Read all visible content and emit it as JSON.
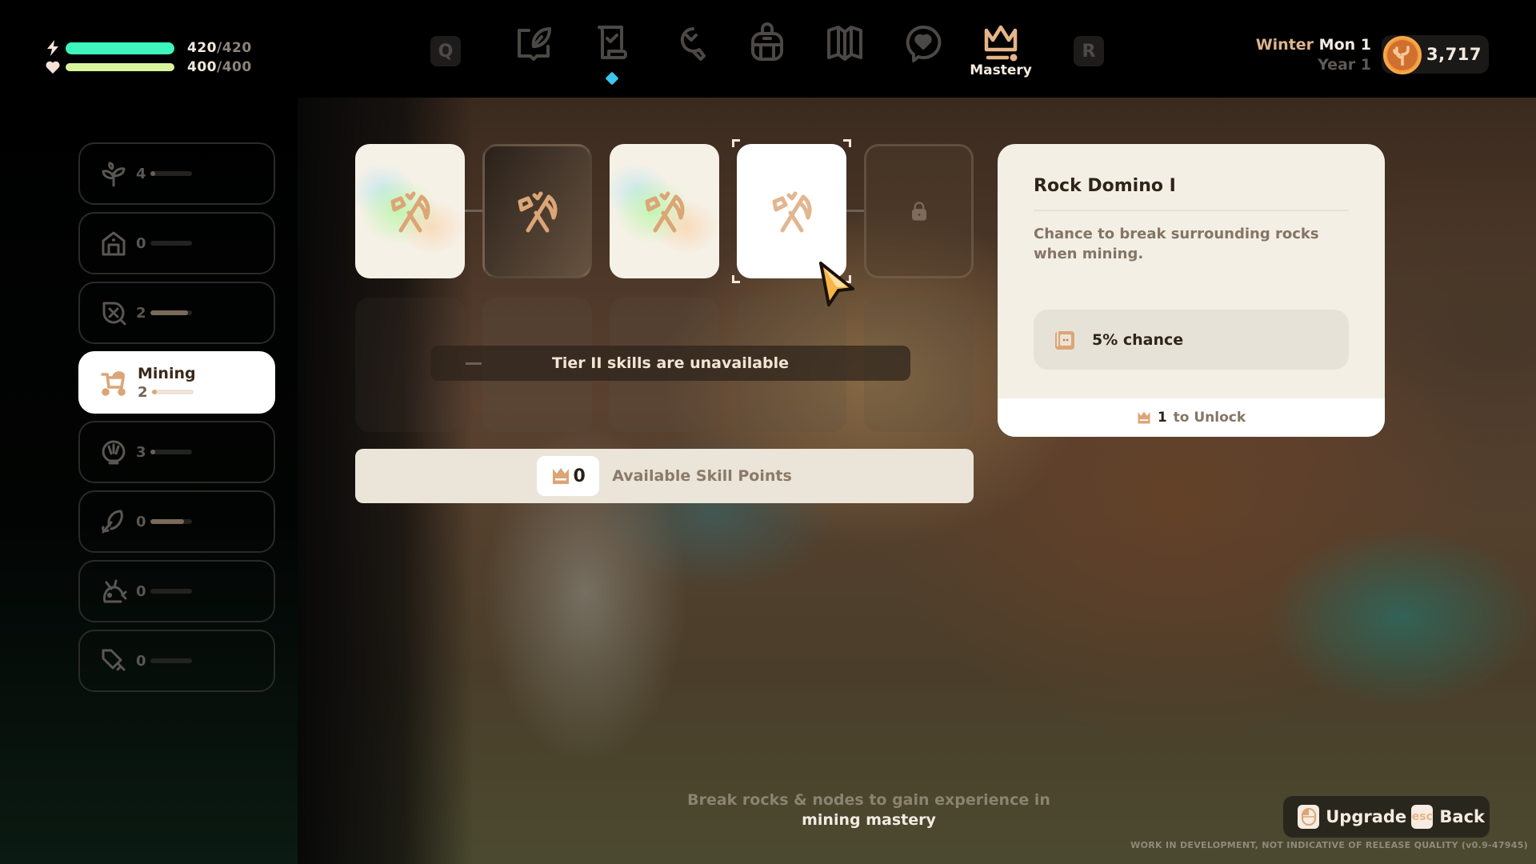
{
  "stats": {
    "energy": {
      "icon": "lightning-icon",
      "current": "420",
      "max": "420",
      "fill": 1.0,
      "color": "#3ef5bb"
    },
    "health": {
      "icon": "heart-icon",
      "current": "400",
      "max": "400",
      "fill": 1.0,
      "color": "#d8f59a"
    }
  },
  "nav": {
    "left_key": "Q",
    "right_key": "R",
    "items": [
      {
        "name": "journal",
        "icon": "leaf-book-icon"
      },
      {
        "name": "quests",
        "icon": "scroll-check-icon",
        "has_notification": true
      },
      {
        "name": "crafting",
        "icon": "wrench-icon"
      },
      {
        "name": "inventory",
        "icon": "backpack-icon"
      },
      {
        "name": "map",
        "icon": "map-icon"
      },
      {
        "name": "relationships",
        "icon": "heart-chat-icon"
      },
      {
        "name": "mastery",
        "icon": "crown-icon",
        "label": "Mastery",
        "active": true
      }
    ],
    "notification_color": "#3cc7ee",
    "active_color": "#e6b48a"
  },
  "calendar": {
    "season": "Winter",
    "day": "Mon 1",
    "year": "Year 1"
  },
  "currency": {
    "icon": "coin-icon",
    "amount": "3,717"
  },
  "sidebar": {
    "items": [
      {
        "icon": "sprout-icon",
        "level": "4",
        "progress": 0.05
      },
      {
        "icon": "barn-icon",
        "level": "0",
        "progress": 0.0
      },
      {
        "icon": "leaf-cross-icon",
        "level": "2",
        "progress": 0.9
      },
      {
        "icon": "mining-cart-icon",
        "name": "Mining",
        "level": "2",
        "progress": 0.05,
        "active": true
      },
      {
        "icon": "shell-icon",
        "level": "3",
        "progress": 0.05
      },
      {
        "icon": "fishing-icon",
        "level": "0",
        "progress": 0.8
      },
      {
        "icon": "fish-icon",
        "level": "0",
        "progress": 0.0
      },
      {
        "icon": "sword-icon",
        "level": "0",
        "progress": 0.0
      }
    ]
  },
  "skills": {
    "tier1": [
      {
        "state": "unlocked",
        "icon": "crossed-axes-icon"
      },
      {
        "state": "available",
        "icon": "crossed-axes-icon"
      },
      {
        "state": "unlocked",
        "icon": "crossed-axes-icon"
      },
      {
        "state": "selected",
        "icon": "crossed-axes-icon"
      },
      {
        "state": "locked",
        "icon": "lock-icon"
      }
    ],
    "tier2_message": "Tier II skills are unavailable",
    "points_value": "0",
    "points_label": "Available Skill Points"
  },
  "detail": {
    "title": "Rock Domino I",
    "description": "Chance to break surrounding rocks when mining.",
    "effect": "5% chance",
    "unlock_cost": "1",
    "unlock_label": "to Unlock"
  },
  "hint": {
    "line1": "Break rocks & nodes to gain experience in",
    "line2": "mining mastery"
  },
  "actions": {
    "upgrade_label": "Upgrade",
    "back_key": "esc",
    "back_label": "Back"
  },
  "watermark": "WORK IN DEVELOPMENT, NOT INDICATIVE OF RELEASE QUALITY (v0.9-47945)"
}
